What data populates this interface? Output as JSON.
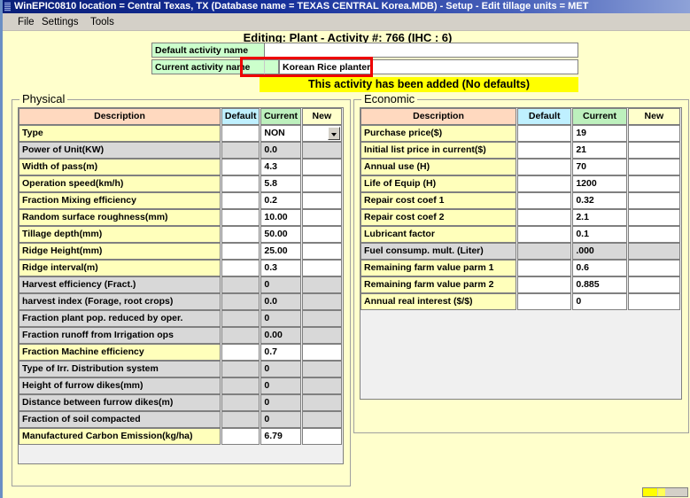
{
  "window": {
    "title": "WinEPIC0810  location = Central Texas, TX    (Database name = TEXAS CENTRAL Korea.MDB) - Setup - Edit tillage  units = MET"
  },
  "menubar": {
    "items": [
      {
        "label": "File"
      },
      {
        "label": "Settings"
      },
      {
        "label": "Tools"
      }
    ]
  },
  "header": {
    "editing_title": "Editing:  Plant - Activity #: 766  (IHC : 6)",
    "default_activity_label": "Default activity name",
    "default_activity_value": "",
    "current_activity_label": "Current activity name",
    "current_activity_value": "Korean Rice planter",
    "status_message": "This activity has been added (No defaults)"
  },
  "physical": {
    "group_title": "Physical",
    "columns": [
      "Description",
      "Default",
      "Current",
      "New"
    ],
    "rows": [
      {
        "desc": "Type",
        "default": "",
        "current": "NON",
        "new": "",
        "enabled": true,
        "combo": true
      },
      {
        "desc": "Power of Unit(KW)",
        "default": "",
        "current": "0.0",
        "new": "",
        "enabled": false,
        "combo": false
      },
      {
        "desc": "Width of pass(m)",
        "default": "",
        "current": "4.3",
        "new": "",
        "enabled": true,
        "combo": false
      },
      {
        "desc": "Operation speed(km/h)",
        "default": "",
        "current": "5.8",
        "new": "",
        "enabled": true,
        "combo": false
      },
      {
        "desc": "Fraction Mixing efficiency",
        "default": "",
        "current": "0.2",
        "new": "",
        "enabled": true,
        "combo": false
      },
      {
        "desc": "Random surface roughness(mm)",
        "default": "",
        "current": "10.00",
        "new": "",
        "enabled": true,
        "combo": false
      },
      {
        "desc": "Tillage depth(mm)",
        "default": "",
        "current": "50.00",
        "new": "",
        "enabled": true,
        "combo": false
      },
      {
        "desc": "Ridge Height(mm)",
        "default": "",
        "current": "25.00",
        "new": "",
        "enabled": true,
        "combo": false
      },
      {
        "desc": "Ridge interval(m)",
        "default": "",
        "current": "0.3",
        "new": "",
        "enabled": true,
        "combo": false
      },
      {
        "desc": "Harvest efficiency (Fract.)",
        "default": "",
        "current": "0",
        "new": "",
        "enabled": false,
        "combo": false
      },
      {
        "desc": "harvest index (Forage, root crops)",
        "default": "",
        "current": "0.0",
        "new": "",
        "enabled": false,
        "combo": false
      },
      {
        "desc": "Fraction plant pop. reduced by oper.",
        "default": "",
        "current": "0",
        "new": "",
        "enabled": false,
        "combo": false
      },
      {
        "desc": "Fraction runoff from Irrigation ops",
        "default": "",
        "current": "0.00",
        "new": "",
        "enabled": false,
        "combo": false
      },
      {
        "desc": "Fraction Machine efficiency",
        "default": "",
        "current": "0.7",
        "new": "",
        "enabled": true,
        "combo": false
      },
      {
        "desc": "Type of Irr. Distribution system",
        "default": "",
        "current": "0",
        "new": "",
        "enabled": false,
        "combo": false
      },
      {
        "desc": "Height of furrow dikes(mm)",
        "default": "",
        "current": "0",
        "new": "",
        "enabled": false,
        "combo": false
      },
      {
        "desc": "Distance between furrow dikes(m)",
        "default": "",
        "current": "0",
        "new": "",
        "enabled": false,
        "combo": false
      },
      {
        "desc": "Fraction of soil compacted",
        "default": "",
        "current": "0",
        "new": "",
        "enabled": false,
        "combo": false
      },
      {
        "desc": "Manufactured Carbon Emission(kg/ha)",
        "default": "",
        "current": "6.79",
        "new": "",
        "enabled": true,
        "combo": false
      }
    ]
  },
  "economic": {
    "group_title": "Economic",
    "columns": [
      "Description",
      "Default",
      "Current",
      "New"
    ],
    "rows": [
      {
        "desc": "Purchase price($)",
        "default": "",
        "current": "19",
        "new": "",
        "enabled": true
      },
      {
        "desc": "Initial list price in current($)",
        "default": "",
        "current": "21",
        "new": "",
        "enabled": true
      },
      {
        "desc": "Annual use (H)",
        "default": "",
        "current": "70",
        "new": "",
        "enabled": true
      },
      {
        "desc": "Life of Equip (H)",
        "default": "",
        "current": "1200",
        "new": "",
        "enabled": true
      },
      {
        "desc": "Repair cost coef 1",
        "default": "",
        "current": "0.32",
        "new": "",
        "enabled": true
      },
      {
        "desc": "Repair cost coef 2",
        "default": "",
        "current": "2.1",
        "new": "",
        "enabled": true
      },
      {
        "desc": "Lubricant factor",
        "default": "",
        "current": "0.1",
        "new": "",
        "enabled": true
      },
      {
        "desc": "Fuel consump. mult. (Liter)",
        "default": "",
        "current": ".000",
        "new": "",
        "enabled": false
      },
      {
        "desc": "Remaining farm value parm 1",
        "default": "",
        "current": "0.6",
        "new": "",
        "enabled": true
      },
      {
        "desc": "Remaining farm value parm 2",
        "default": "",
        "current": "0.885",
        "new": "",
        "enabled": true
      },
      {
        "desc": "Annual real interest ($/$)",
        "default": "",
        "current": "0",
        "new": "",
        "enabled": true
      }
    ]
  },
  "colors": {
    "page_background": "#ffffcc",
    "titlebar_start": "#0a1f78",
    "header_description": "#ffd9bf",
    "header_default": "#bff0ff",
    "header_current": "#bdf0bd",
    "header_new": "#ffffcc",
    "row_enabled": "#ffffbb",
    "row_disabled": "#d8d8d8",
    "status_highlight": "#ffff00",
    "focus_outline": "#ee0000"
  }
}
